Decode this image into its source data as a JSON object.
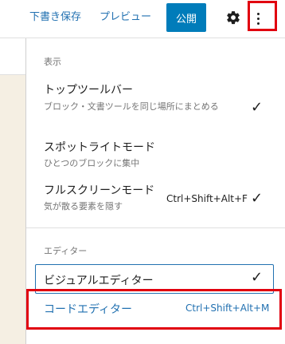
{
  "toolbar": {
    "save_draft": "下書き保存",
    "preview": "プレビュー",
    "publish": "公開",
    "settings_icon": "gear-icon",
    "more_icon": "vertical-ellipsis-icon",
    "accent": "#007cba",
    "link_color": "#2271b1"
  },
  "menu": {
    "view_group": {
      "label": "表示",
      "items": [
        {
          "title": "トップツールバー",
          "description": "ブロック・文書ツールを同じ場所にまとめる",
          "checked": true,
          "shortcut": ""
        },
        {
          "title": "スポットライトモード",
          "description": "ひとつのブロックに集中",
          "checked": false,
          "shortcut": ""
        },
        {
          "title": "フルスクリーンモード",
          "description": "気が散る要素を隠す",
          "checked": true,
          "shortcut": "Ctrl+Shift+Alt+F"
        }
      ]
    },
    "editor_group": {
      "label": "エディター",
      "items": [
        {
          "title": "ビジュアルエディター",
          "checked": true,
          "shortcut": ""
        },
        {
          "title": "コードエディター",
          "checked": false,
          "shortcut": "Ctrl+Shift+Alt+M"
        }
      ]
    },
    "check_glyph": "✓"
  },
  "highlight_color": "#e1000f"
}
